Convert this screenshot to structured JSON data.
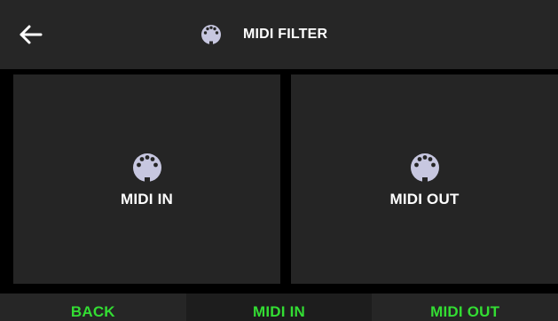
{
  "header": {
    "title": "MIDI FILTER",
    "back_icon": "arrow-left-icon",
    "title_icon": "midi-connector-icon"
  },
  "tiles": [
    {
      "label": "MIDI IN",
      "icon": "midi-connector-icon"
    },
    {
      "label": "MIDI OUT",
      "icon": "midi-connector-icon"
    }
  ],
  "bottom_bar": {
    "buttons": [
      {
        "label": "BACK"
      },
      {
        "label": "MIDI IN"
      },
      {
        "label": "MIDI OUT"
      }
    ]
  },
  "colors": {
    "background": "#000000",
    "panel": "#262626",
    "text": "#ffffff",
    "accent": "#33dd33",
    "icon": "#c7c7e0"
  }
}
